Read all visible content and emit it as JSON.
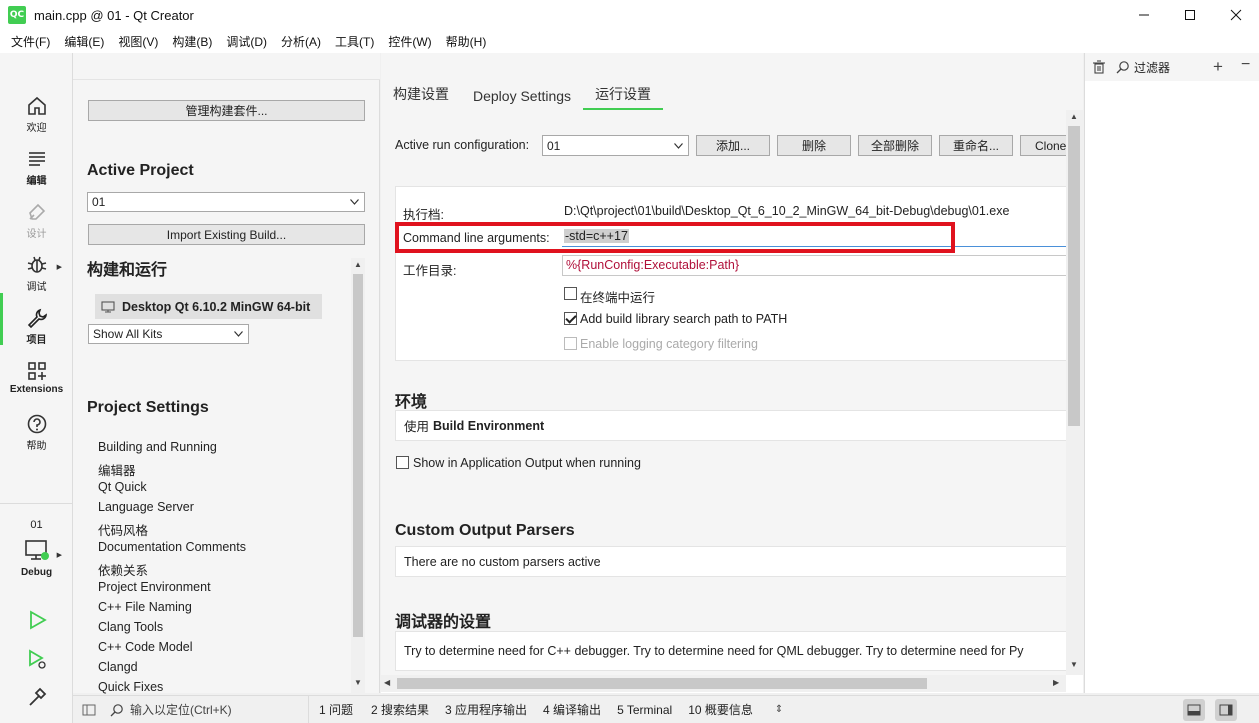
{
  "window": {
    "icon_text": "QC",
    "title": "main.cpp @ 01 - Qt Creator"
  },
  "menu": [
    "文件(F)",
    "编辑(E)",
    "视图(V)",
    "构建(B)",
    "调试(D)",
    "分析(A)",
    "工具(T)",
    "控件(W)",
    "帮助(H)"
  ],
  "modes": {
    "welcome": "欢迎",
    "edit": "编辑",
    "design": "设计",
    "debug": "调试",
    "projects": "项目",
    "extensions": "Extensions",
    "help": "帮助",
    "target_project": "01",
    "target_label": "Debug"
  },
  "sidepanel": {
    "manage_kits": "管理构建套件...",
    "active_project_heading": "Active Project",
    "project_value": "01",
    "import_build": "Import Existing Build...",
    "build_run_heading": "构建和运行",
    "kit_name": "Desktop Qt 6.10.2 MinGW 64-bit",
    "show_kits": "Show All Kits",
    "project_settings_heading": "Project Settings",
    "settings_items": [
      "Building and Running",
      "编辑器",
      "Qt Quick",
      "Language Server",
      "代码风格",
      "Documentation Comments",
      "依赖关系",
      "Project Environment",
      "C++ File Naming",
      "Clang Tools",
      "C++ Code Model",
      "Clangd",
      "Quick Fixes"
    ]
  },
  "tabs": [
    "构建设置",
    "Deploy Settings",
    "运行设置"
  ],
  "run": {
    "active_config_label": "Active run configuration:",
    "active_config_value": "01",
    "add_button": "添加...",
    "remove_button": "删除",
    "remove_all_button": "全部删除",
    "rename_button": "重命名...",
    "clone_button": "Clone",
    "executable_label": "执行档:",
    "executable_value": "D:\\Qt\\project\\01\\build\\Desktop_Qt_6_10_2_MinGW_64_bit-Debug\\debug\\01.exe",
    "args_label": "Command line arguments:",
    "args_value": "-std=c++17",
    "workdir_label": "工作目录:",
    "workdir_value": "%{RunConfig:Executable:Path}",
    "run_in_terminal": "在终端中运行",
    "add_lib_path": "Add build library search path to PATH",
    "enable_logging": "Enable logging category filtering",
    "env_heading": "环境",
    "env_prefix": "使用",
    "env_value": "Build Environment",
    "show_app_output": "Show in Application Output when running",
    "parsers_heading": "Custom Output Parsers",
    "parsers_text": "There are no custom parsers active",
    "debugger_heading": "调试器的设置",
    "debugger_text": "Try to determine need for C++ debugger. Try to determine need for QML debugger. Try to determine need for Py"
  },
  "rightpanel": {
    "filter": "过滤器"
  },
  "status": {
    "locate_placeholder": "输入以定位(Ctrl+K)",
    "items": [
      "1  问题",
      "2  搜索结果",
      "3  应用程序输出",
      "4  编译输出",
      "5  Terminal",
      "10  概要信息"
    ]
  },
  "colors": {
    "accent": "#41cd52",
    "highlight_box": "#e0121e",
    "workdir_text": "#b0103a"
  }
}
